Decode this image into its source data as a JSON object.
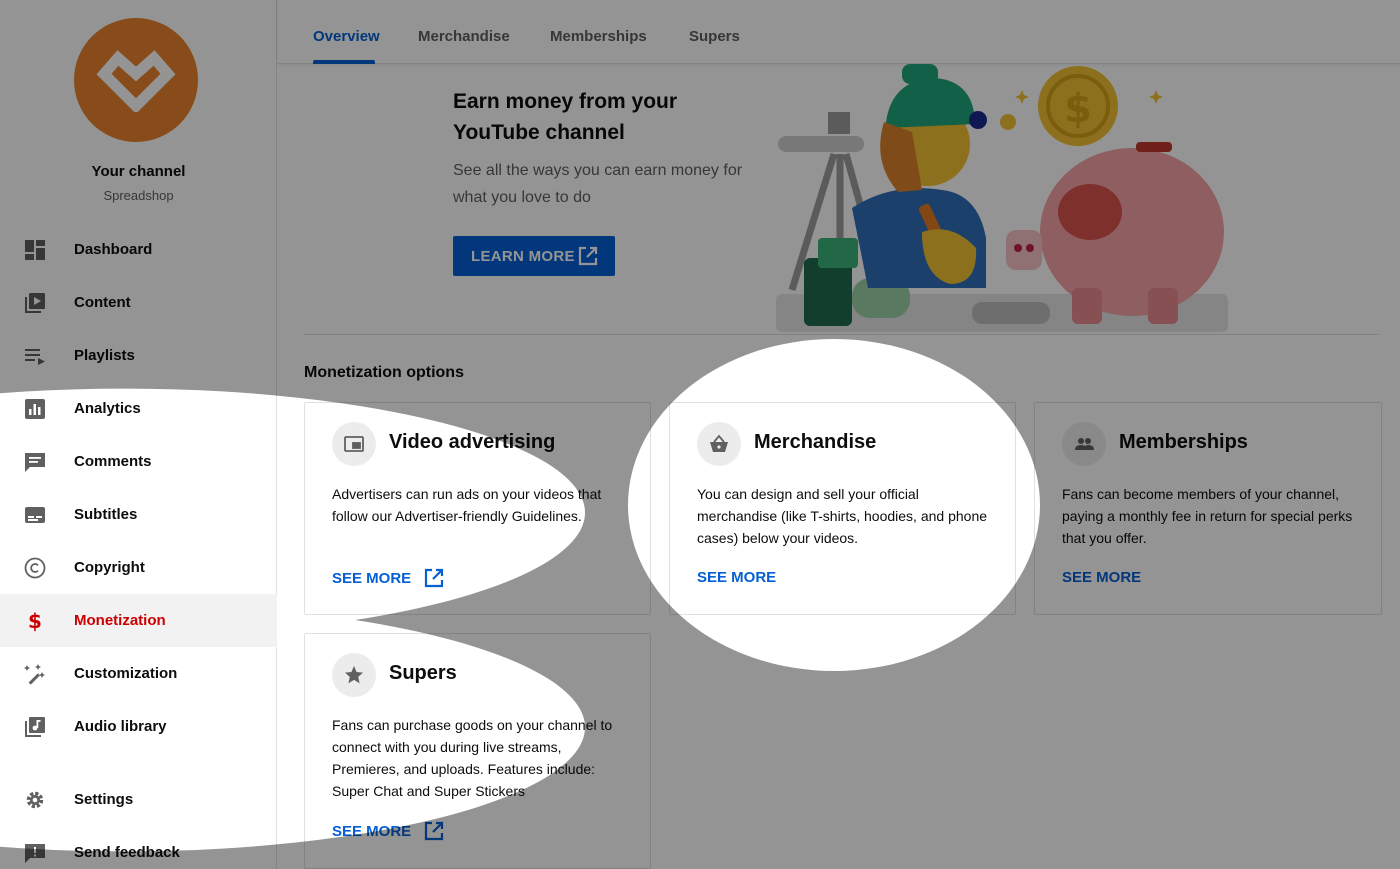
{
  "sidebar": {
    "channel_title": "Your channel",
    "channel_subtitle": "Spreadshop",
    "avatar_color": "#e8842b",
    "items": [
      {
        "label": "Dashboard",
        "icon": "dashboard-icon"
      },
      {
        "label": "Content",
        "icon": "content-icon"
      },
      {
        "label": "Playlists",
        "icon": "playlists-icon"
      },
      {
        "label": "Analytics",
        "icon": "analytics-icon"
      },
      {
        "label": "Comments",
        "icon": "comments-icon"
      },
      {
        "label": "Subtitles",
        "icon": "subtitles-icon"
      },
      {
        "label": "Copyright",
        "icon": "copyright-icon"
      },
      {
        "label": "Monetization",
        "icon": "dollar-icon",
        "active": true
      },
      {
        "label": "Customization",
        "icon": "magic-wand-icon"
      },
      {
        "label": "Audio library",
        "icon": "audio-library-icon"
      },
      {
        "label": "Settings",
        "icon": "gear-icon"
      },
      {
        "label": "Send feedback",
        "icon": "feedback-icon"
      }
    ]
  },
  "tabs": [
    {
      "label": "Overview",
      "active": true
    },
    {
      "label": "Merchandise"
    },
    {
      "label": "Memberships"
    },
    {
      "label": "Supers"
    }
  ],
  "hero": {
    "title": "Earn money from your YouTube channel",
    "subtitle": "See all the ways you can earn money for what you love to do",
    "button_label": "LEARN MORE"
  },
  "monetization": {
    "section_title": "Monetization options",
    "cards": [
      {
        "title": "Video advertising",
        "icon": "video-ad-icon",
        "description": "Advertisers can run ads on your videos that follow our Advertiser-friendly Guidelines.",
        "link": "SEE MORE"
      },
      {
        "title": "Merchandise",
        "icon": "shopping-basket-icon",
        "description": "You can design and sell your official merchandise (like T-shirts, hoodies, and phone cases) below your videos.",
        "link": "SEE MORE"
      },
      {
        "title": "Memberships",
        "icon": "people-icon",
        "description": "Fans can become members of your channel, paying a monthly fee in return for special perks that you offer.",
        "link": "SEE MORE"
      },
      {
        "title": "Supers",
        "icon": "star-icon",
        "description": "Fans can purchase goods on your channel to connect with you during live streams, Premieres, and uploads. Features include: Super Chat and Super Stickers",
        "link": "SEE MORE"
      }
    ]
  },
  "colors": {
    "accent_blue": "#065fd4",
    "active_red": "#cc0000",
    "overlay": "rgba(0,0,0,0.42)"
  }
}
